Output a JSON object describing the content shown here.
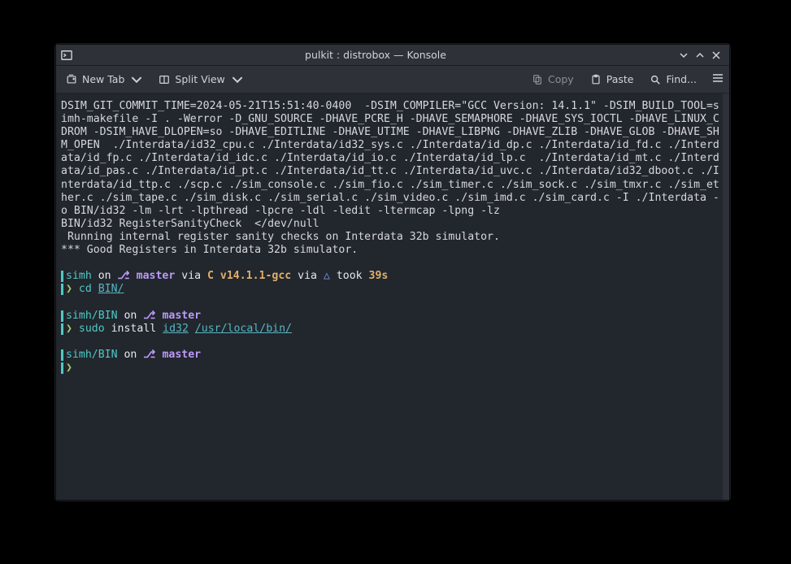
{
  "title": "pulkit : distrobox — Konsole",
  "toolbar": {
    "new_tab": "New Tab",
    "split_view": "Split View",
    "copy": "Copy",
    "paste": "Paste",
    "find": "Find..."
  },
  "term": {
    "compile_block": "DSIM_GIT_COMMIT_TIME=2024-05-21T15:51:40-0400  -DSIM_COMPILER=\"GCC Version: 14.1.1\" -DSIM_BUILD_TOOL=simh-makefile -I . -Werror -D_GNU_SOURCE -DHAVE_PCRE_H -DHAVE_SEMAPHORE -DHAVE_SYS_IOCTL -DHAVE_LINUX_CDROM -DSIM_HAVE_DLOPEN=so -DHAVE_EDITLINE -DHAVE_UTIME -DHAVE_LIBPNG -DHAVE_ZLIB -DHAVE_GLOB -DHAVE_SHM_OPEN  ./Interdata/id32_cpu.c ./Interdata/id32_sys.c ./Interdata/id_dp.c ./Interdata/id_fd.c ./Interdata/id_fp.c ./Interdata/id_idc.c ./Interdata/id_io.c ./Interdata/id_lp.c  ./Interdata/id_mt.c ./Interdata/id_pas.c ./Interdata/id_pt.c ./Interdata/id_tt.c ./Interdata/id_uvc.c ./Interdata/id32_dboot.c ./Interdata/id_ttp.c ./scp.c ./sim_console.c ./sim_fio.c ./sim_timer.c ./sim_sock.c ./sim_tmxr.c ./sim_ether.c ./sim_tape.c ./sim_disk.c ./sim_serial.c ./sim_video.c ./sim_imd.c ./sim_card.c -I ./Interdata -o BIN/id32 -lm -lrt -lpthread -lpcre -ldl -ledit -ltermcap -lpng -lz",
    "sanity_cmd": "BIN/id32 RegisterSanityCheck  </dev/null",
    "sanity_run": " Running internal register sanity checks on Interdata 32b simulator.",
    "sanity_good": "*** Good Registers in Interdata 32b simulator.",
    "p1": {
      "dir": "simh",
      "on": " on ",
      "branch_icon": "⎇",
      "branch": " master",
      "via1": " via ",
      "compiler": "C v14.1.1-gcc",
      "via2": " via ",
      "tri": "△ ",
      "took": "took ",
      "dur": "39s",
      "prompt": "❯ ",
      "cmd1": "cd ",
      "arg1": "BIN/"
    },
    "p2": {
      "dir": "simh/BIN",
      "on": " on ",
      "branch_icon": "⎇",
      "branch": " master",
      "prompt": "❯ ",
      "cmd1": "sudo",
      "sp": " ",
      "cmd2": "install ",
      "arg1": "id32",
      "arg2": "/usr/local/bin/"
    },
    "p3": {
      "dir": "simh/BIN",
      "on": " on ",
      "branch_icon": "⎇",
      "branch": " master",
      "prompt": "❯"
    }
  }
}
